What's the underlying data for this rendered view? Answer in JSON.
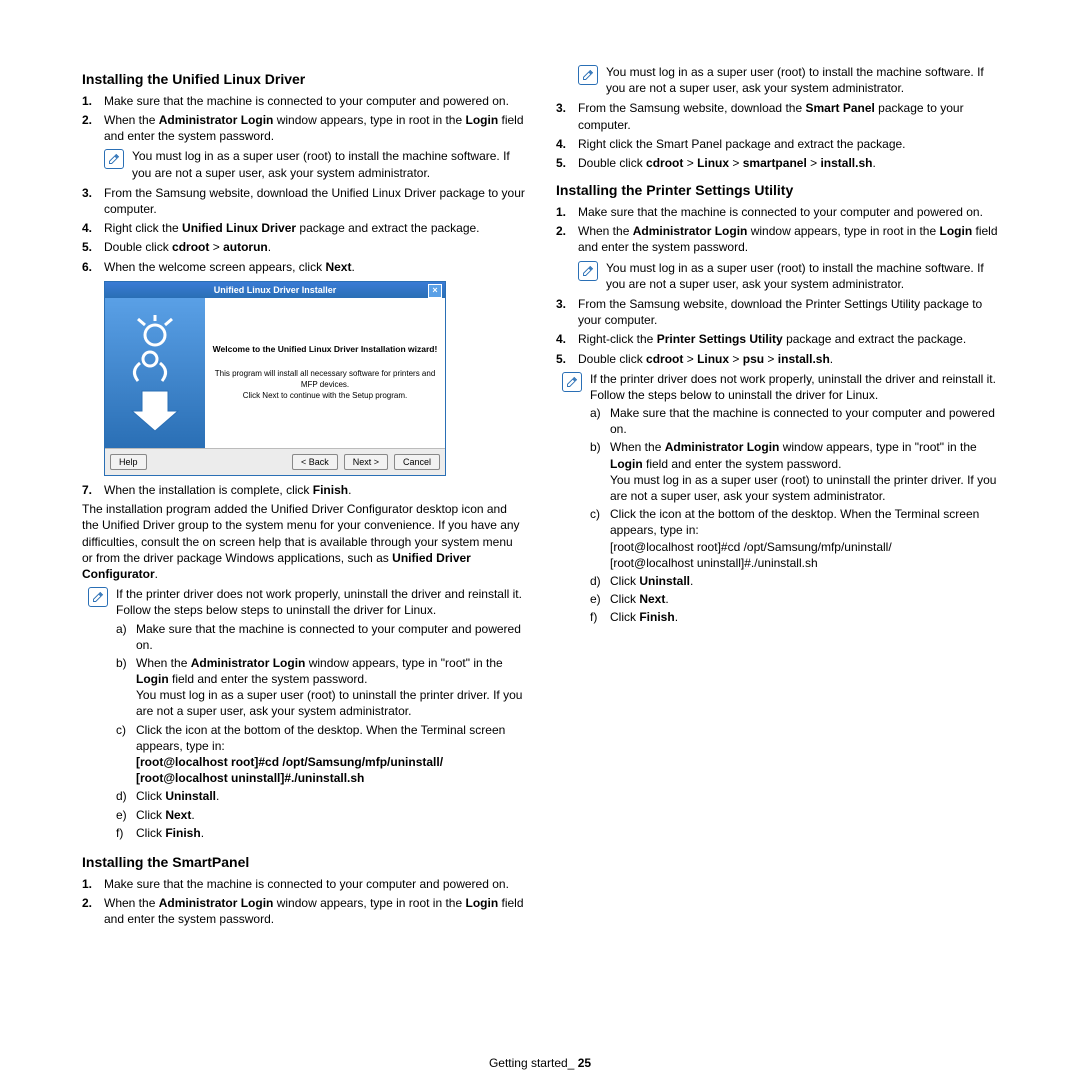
{
  "left": {
    "sec1_title": "Installing the Unified Linux Driver",
    "s1_1": "Make sure that the machine is connected to your computer and powered on.",
    "s1_2a": "When the ",
    "s1_2b": "Administrator Login",
    "s1_2c": " window appears, type in root in the ",
    "s1_2d": "Login",
    "s1_2e": " field and enter the system password.",
    "note1": "You must log in as a super user (root) to install the machine software. If you are not a super user, ask your system administrator.",
    "s1_3": "From the Samsung website, download the Unified Linux Driver package to your computer.",
    "s1_4a": "Right click the ",
    "s1_4b": "Unified Linux Driver",
    "s1_4c": " package and extract the package.",
    "s1_5a": "Double click ",
    "s1_5b": "cdroot",
    "s1_5c": " > ",
    "s1_5d": "autorun",
    "s1_5e": ".",
    "s1_6a": "When the welcome screen appears, click ",
    "s1_6b": "Next",
    "s1_6c": ".",
    "wizard_title": "Unified Linux Driver Installer",
    "wizard_welcome": "Welcome to the Unified Linux Driver Installation wizard!",
    "wizard_l1": "This program will install all necessary software for printers and MFP devices.",
    "wizard_l2": "Click Next to continue with the Setup program.",
    "wizard_help": "Help",
    "wizard_back": "< Back",
    "wizard_next": "Next >",
    "wizard_cancel": "Cancel",
    "s1_7a": "When the installation is complete, click ",
    "s1_7b": "Finish",
    "s1_7c": ".",
    "after7a": "The installation program added the Unified Driver Configurator desktop icon and the Unified Driver group to the system menu for your convenience. If you have any difficulties, consult the on screen help that is available through your system menu or from the driver package Windows applications, such as ",
    "after7b": "Unified Driver Configurator",
    "after7c": ".",
    "note2_l1": "If the printer driver does not work properly, uninstall the driver and reinstall it.",
    "note2_l2": "Follow the steps below steps to uninstall the driver for Linux.",
    "u_a": "Make sure that the machine is connected to your computer and powered on.",
    "u_b1": "When the ",
    "u_b2": "Administrator Login",
    "u_b3": " window appears, type in \"root\" in the ",
    "u_b4": "Login",
    "u_b5": " field and enter the system password.",
    "u_b6": "You must log in as a super user (root) to uninstall the printer driver. If you are not a super user, ask your system administrator.",
    "u_c1": "Click the icon at the bottom of the desktop. When the Terminal screen appears, type in:",
    "u_c2": "[root@localhost root]#cd /opt/Samsung/mfp/uninstall/",
    "u_c3": "[root@localhost uninstall]#./uninstall.sh",
    "u_d1": "Click ",
    "u_d2": "Uninstall",
    "u_d3": ".",
    "u_e1": "Click ",
    "u_e2": "Next",
    "u_e3": ".",
    "u_f1": "Click ",
    "u_f2": "Finish",
    "u_f3": ".",
    "sec2_title": "Installing the SmartPanel",
    "s2_1": "Make sure that the machine is connected to your computer and powered on.",
    "s2_2a": "When the ",
    "s2_2b": "Administrator Login",
    "s2_2c": " window appears, type in root in the ",
    "s2_2d": "Login",
    "s2_2e": " field and enter the system password."
  },
  "right": {
    "note1": "You must log in as a super user (root) to install the machine software. If you are not a super user, ask your system administrator.",
    "sp_3a": "From the Samsung website, download the ",
    "sp_3b": "Smart Panel",
    "sp_3c": " package to your computer.",
    "sp_4": "Right click the Smart Panel package and extract the package.",
    "sp_5a": "Double click ",
    "sp_5b": "cdroot",
    "sp_5c": " > ",
    "sp_5d": "Linux",
    "sp_5e": " > ",
    "sp_5f": "smartpanel",
    "sp_5g": " > ",
    "sp_5h": "install.sh",
    "sp_5i": ".",
    "sec3_title": "Installing the Printer Settings Utility",
    "p_1": "Make sure that the machine is connected to your computer and powered on.",
    "p_2a": "When the ",
    "p_2b": "Administrator Login",
    "p_2c": " window appears, type in root in the ",
    "p_2d": "Login",
    "p_2e": " field and enter the system password.",
    "note2": "You must log in as a super user (root) to install the machine software. If you are not a super user, ask your system administrator.",
    "p_3": "From the Samsung website, download the Printer Settings Utility package to your computer.",
    "p_4a": "Right-click the ",
    "p_4b": "Printer Settings Utility",
    "p_4c": " package and extract the package.",
    "p_5a": "Double click ",
    "p_5b": "cdroot",
    "p_5c": " > ",
    "p_5d": "Linux",
    "p_5e": " > ",
    "p_5f": "psu",
    "p_5g": " > ",
    "p_5h": "install.sh",
    "p_5i": ".",
    "note3_l1": "If the printer driver does not work properly, uninstall the driver and reinstall it.",
    "note3_l2": "Follow the steps below to uninstall the driver for Linux.",
    "u_a": "Make sure that the machine is connected to your computer and powered on.",
    "u_b1": "When the ",
    "u_b2": "Administrator Login",
    "u_b3": " window appears, type in \"root\" in the ",
    "u_b4": "Login",
    "u_b5": " field and enter the system password.",
    "u_b6": "You must log in as a super user (root) to uninstall the printer driver. If you are not a super user, ask your system administrator.",
    "u_c1": "Click the icon at the bottom of the desktop. When the Terminal screen appears, type in:",
    "u_c2": "[root@localhost root]#cd /opt/Samsung/mfp/uninstall/",
    "u_c3": "[root@localhost uninstall]#./uninstall.sh",
    "u_d1": "Click ",
    "u_d2": "Uninstall",
    "u_d3": ".",
    "u_e1": "Click ",
    "u_e2": "Next",
    "u_e3": ".",
    "u_f1": "Click ",
    "u_f2": "Finish",
    "u_f3": "."
  },
  "footer_label": "Getting started",
  "footer_sep": "_ ",
  "footer_page": "25"
}
